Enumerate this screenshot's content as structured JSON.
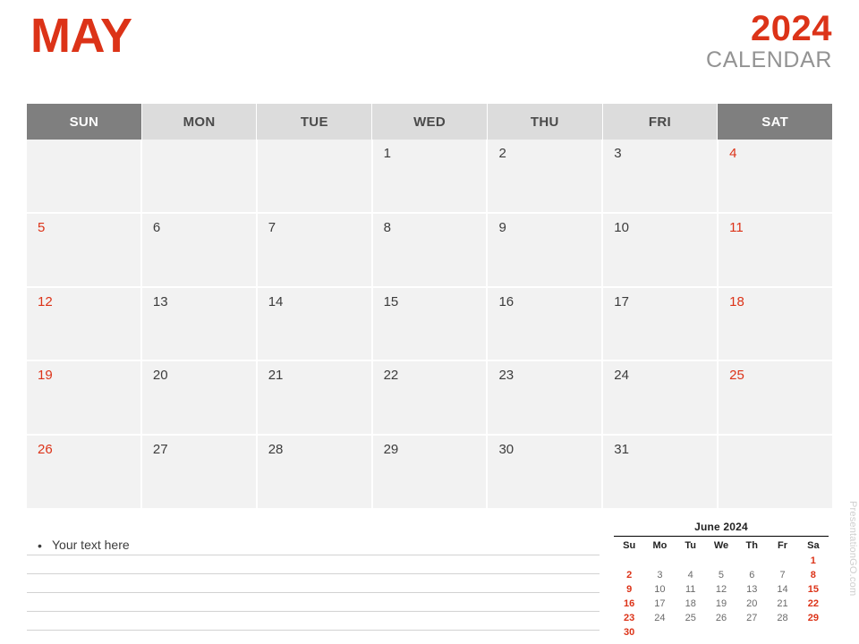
{
  "header": {
    "month": "MAY",
    "year": "2024",
    "calendar_word": "CALENDAR",
    "accent_color": "#DC3318",
    "muted_color": "#939393"
  },
  "main_calendar": {
    "weekdays": [
      {
        "label": "SUN",
        "weekend": true
      },
      {
        "label": "MON",
        "weekend": false
      },
      {
        "label": "TUE",
        "weekend": false
      },
      {
        "label": "WED",
        "weekend": false
      },
      {
        "label": "THU",
        "weekend": false
      },
      {
        "label": "FRI",
        "weekend": false
      },
      {
        "label": "SAT",
        "weekend": true
      }
    ],
    "weeks": [
      [
        "",
        "",
        "",
        "1",
        "2",
        "3",
        "4"
      ],
      [
        "5",
        "6",
        "7",
        "8",
        "9",
        "10",
        "11"
      ],
      [
        "12",
        "13",
        "14",
        "15",
        "16",
        "17",
        "18"
      ],
      [
        "19",
        "20",
        "21",
        "22",
        "23",
        "24",
        "25"
      ],
      [
        "26",
        "27",
        "28",
        "29",
        "30",
        "31",
        ""
      ]
    ],
    "header_weekend_bg": "#7f7f7f",
    "header_weekday_bg": "#dcdcdc",
    "cell_bg": "#f2f2f2"
  },
  "notes": {
    "bullet": "•",
    "text": "Your text here",
    "line_count": 5
  },
  "mini_calendar": {
    "title": "June 2024",
    "weekdays": [
      "Su",
      "Mo",
      "Tu",
      "We",
      "Th",
      "Fr",
      "Sa"
    ],
    "weeks": [
      [
        "",
        "",
        "",
        "",
        "",
        "",
        "1"
      ],
      [
        "2",
        "3",
        "4",
        "5",
        "6",
        "7",
        "8"
      ],
      [
        "9",
        "10",
        "11",
        "12",
        "13",
        "14",
        "15"
      ],
      [
        "16",
        "17",
        "18",
        "19",
        "20",
        "21",
        "22"
      ],
      [
        "23",
        "24",
        "25",
        "26",
        "27",
        "28",
        "29"
      ],
      [
        "30",
        "",
        "",
        "",
        "",
        "",
        ""
      ]
    ]
  },
  "watermark": {
    "text": "PresentationGO.com"
  }
}
